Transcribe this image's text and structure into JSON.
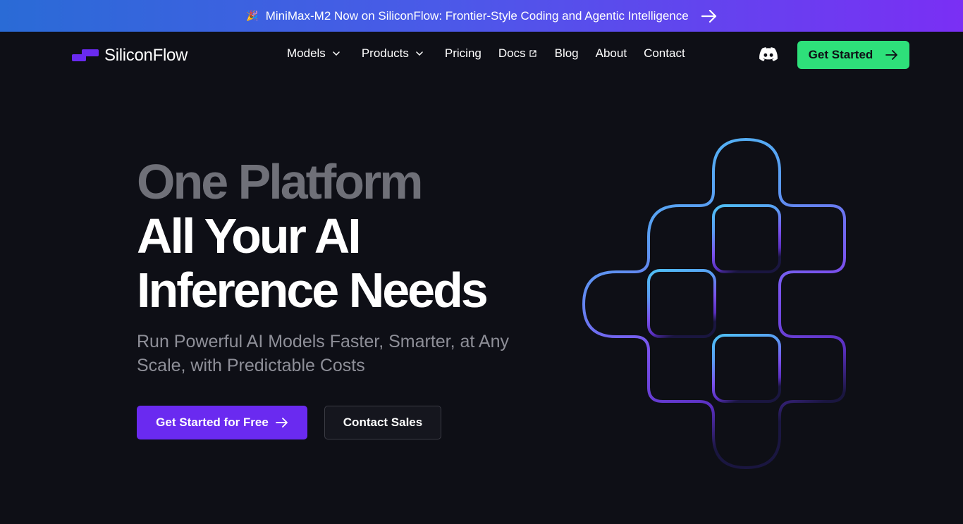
{
  "announcement": {
    "emoji": "🎉",
    "text": "MiniMax-M2 Now on SiliconFlow: Frontier-Style Coding and Agentic Intelligence",
    "icon": "arrow-right-icon"
  },
  "brand": {
    "name": "SiliconFlow",
    "accent": "#6a2af0",
    "cta_color": "#2ee07a"
  },
  "nav": {
    "items": [
      {
        "label": "Models",
        "icon": "chevron-down-icon"
      },
      {
        "label": "Products",
        "icon": "chevron-down-icon"
      },
      {
        "label": "Pricing"
      },
      {
        "label": "Docs",
        "icon": "external-link-icon"
      },
      {
        "label": "Blog"
      },
      {
        "label": "About"
      },
      {
        "label": "Contact"
      }
    ],
    "discord_icon": "discord-icon",
    "cta_label": "Get Started"
  },
  "hero": {
    "title_line1": "One Platform",
    "title_line2": "All Your AI",
    "title_line3": "Inference Needs",
    "subtitle": "Run Powerful AI Models Faster, Smarter, at Any Scale,  with Predictable Costs",
    "primary_cta": "Get Started for Free",
    "secondary_cta": "Contact Sales"
  }
}
